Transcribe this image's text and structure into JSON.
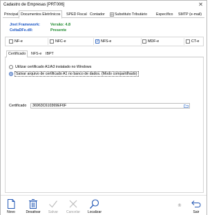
{
  "window": {
    "title": "Cadastro de Empresas [PRT006]",
    "close_glyph": "✕"
  },
  "tabs": [
    {
      "label": "Principal",
      "active": false
    },
    {
      "label": "Documentos Eletrônicos",
      "active": true
    },
    {
      "label": "SPED Fiscal",
      "active": false
    },
    {
      "label": "Contador",
      "active": false
    },
    {
      "label": "Substituto Tributário",
      "active": false
    },
    {
      "label": "Específico",
      "active": false
    },
    {
      "label": "SMTP (e-mail)",
      "active": false
    }
  ],
  "info": {
    "jnet_label": "Jnet Framework:",
    "jnet_value": "Versão: 4.8",
    "celta_label": "CeltaDFe.dll:",
    "celta_value": "Presente"
  },
  "doc_types": [
    {
      "label": "NF-e",
      "checked": false
    },
    {
      "label": "NFC-e",
      "checked": false
    },
    {
      "label": "NFS-e",
      "checked": true
    },
    {
      "label": "MDF-e",
      "checked": false
    },
    {
      "label": "CT-e",
      "checked": false
    }
  ],
  "subtabs": [
    {
      "label": "Certificado",
      "active": true
    },
    {
      "label": "NFS-e",
      "active": false
    },
    {
      "label": "IBPT",
      "active": false
    }
  ],
  "certificate": {
    "option1": "Utilizar certificado A1/A3 instalado no Windows",
    "option2": "Salvar arquivo de certificado A1 no banco de dados. (Modo compartilhado)",
    "selected_option": 2,
    "field_label": "Certificado",
    "field_value": "36963C610369EF6F"
  },
  "toolbar": {
    "novo": "Novo",
    "desativar": "Desativar",
    "salvar": "Salvar",
    "cancelar": "Cancelar",
    "localizar": "Localizar",
    "sair": "Sair",
    "registered_glyph": "®"
  },
  "colors": {
    "accent": "#2257b5",
    "info_label": "#1a55c4",
    "info_value": "#1e8a2e",
    "disabled": "#9a9a9a"
  }
}
